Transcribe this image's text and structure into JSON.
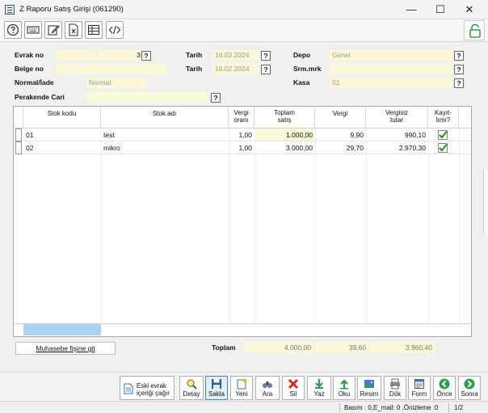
{
  "window": {
    "title": "Z Raporu Satış Girişi (061290)",
    "minimize": "—",
    "maximize": "☐",
    "close": "✕"
  },
  "toolbar": {
    "icons": [
      "help-icon",
      "keyboard-icon",
      "edit-icon",
      "excel-icon",
      "table-icon",
      "code-icon",
      "lock-icon"
    ]
  },
  "form": {
    "evrak_no_label": "Evrak no",
    "evrak_no_value": "3",
    "belge_no_label": "Belge no",
    "normal_iade_label": "Normal/İade",
    "normal_iade_value": "Normal",
    "perakende_cari_label": "Perakende Cari",
    "tarih_label": "Tarih",
    "tarih1_value": "16.02.2024",
    "tarih2_value": "16.02.2024",
    "depo_label": "Depo",
    "depo_value": "Genel",
    "srm_label": "Srm.mrk",
    "kasa_label": "Kasa",
    "kasa_value": "01",
    "lookup": "?"
  },
  "grid": {
    "headers": {
      "stok_kodu": "Stok kodu",
      "stok_adi": "Stok adı",
      "vergi_orani_1": "Vergi",
      "vergi_orani_2": "oranı",
      "toplam_satis_1": "Toplam",
      "toplam_satis_2": "satış",
      "vergi": "Vergi",
      "vergisiz_1": "Vergisiz",
      "vergisiz_2": "tutar",
      "kayitli_1": "Kayıt-",
      "kayitli_2": "lımı?"
    },
    "rows": [
      {
        "kod": "01",
        "ad": "test",
        "oran": "1,00",
        "toplam": "1.000,00",
        "vergi": "9,90",
        "vergisiz": "990,10",
        "kayitli": true
      },
      {
        "kod": "02",
        "ad": "mikro",
        "oran": "1,00",
        "toplam": "3.000,00",
        "vergi": "29,70",
        "vergisiz": "2.970,30",
        "kayitli": true
      }
    ]
  },
  "totals": {
    "label": "Toplam",
    "toplam": "4.000,00",
    "vergi": "39,60",
    "vergisiz": "3.960,40"
  },
  "muhasebe_button": "Muhasebe fişine git",
  "bottom": {
    "eski_1": "Eski evrak",
    "eski_2": "içeriği çağır",
    "detay": "Detay",
    "sakla": "Sakla",
    "yeni": "Yeni",
    "ara": "Ara",
    "sil": "Sil",
    "yaz": "Yaz",
    "oku": "Oku",
    "resim": "Resim",
    "dok": "Dök",
    "form": "Form",
    "once": "Önce",
    "sonra": "Sonra"
  },
  "status": {
    "info": "Basım : 0,E_mail: 0 ,Önizleme :0",
    "page": "1/2"
  },
  "colors": {
    "field_bg": "#fbf8d7",
    "selection": "#a9d0f5",
    "check": "#1f8f1f"
  }
}
